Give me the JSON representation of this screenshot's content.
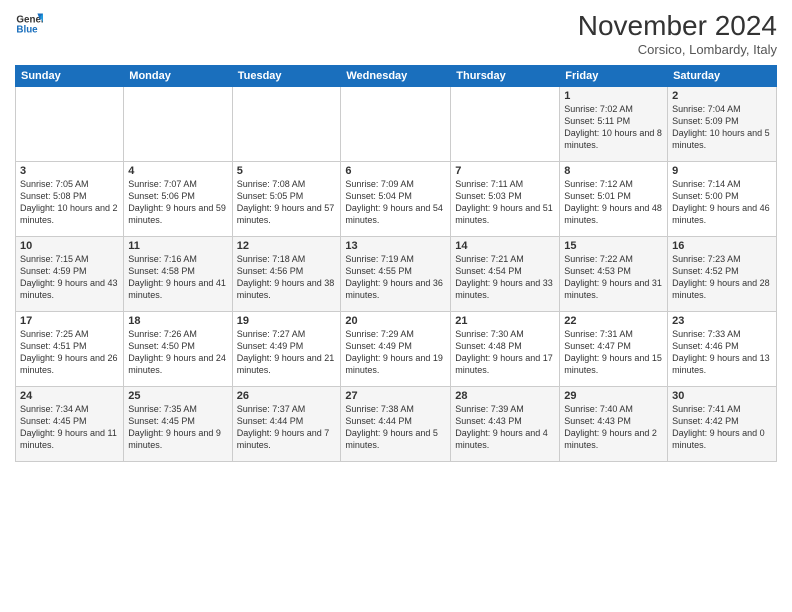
{
  "header": {
    "logo_line1": "General",
    "logo_line2": "Blue",
    "month": "November 2024",
    "location": "Corsico, Lombardy, Italy"
  },
  "weekdays": [
    "Sunday",
    "Monday",
    "Tuesday",
    "Wednesday",
    "Thursday",
    "Friday",
    "Saturday"
  ],
  "rows": [
    [
      {
        "day": "",
        "info": ""
      },
      {
        "day": "",
        "info": ""
      },
      {
        "day": "",
        "info": ""
      },
      {
        "day": "",
        "info": ""
      },
      {
        "day": "",
        "info": ""
      },
      {
        "day": "1",
        "info": "Sunrise: 7:02 AM\nSunset: 5:11 PM\nDaylight: 10 hours and 8 minutes."
      },
      {
        "day": "2",
        "info": "Sunrise: 7:04 AM\nSunset: 5:09 PM\nDaylight: 10 hours and 5 minutes."
      }
    ],
    [
      {
        "day": "3",
        "info": "Sunrise: 7:05 AM\nSunset: 5:08 PM\nDaylight: 10 hours and 2 minutes."
      },
      {
        "day": "4",
        "info": "Sunrise: 7:07 AM\nSunset: 5:06 PM\nDaylight: 9 hours and 59 minutes."
      },
      {
        "day": "5",
        "info": "Sunrise: 7:08 AM\nSunset: 5:05 PM\nDaylight: 9 hours and 57 minutes."
      },
      {
        "day": "6",
        "info": "Sunrise: 7:09 AM\nSunset: 5:04 PM\nDaylight: 9 hours and 54 minutes."
      },
      {
        "day": "7",
        "info": "Sunrise: 7:11 AM\nSunset: 5:03 PM\nDaylight: 9 hours and 51 minutes."
      },
      {
        "day": "8",
        "info": "Sunrise: 7:12 AM\nSunset: 5:01 PM\nDaylight: 9 hours and 48 minutes."
      },
      {
        "day": "9",
        "info": "Sunrise: 7:14 AM\nSunset: 5:00 PM\nDaylight: 9 hours and 46 minutes."
      }
    ],
    [
      {
        "day": "10",
        "info": "Sunrise: 7:15 AM\nSunset: 4:59 PM\nDaylight: 9 hours and 43 minutes."
      },
      {
        "day": "11",
        "info": "Sunrise: 7:16 AM\nSunset: 4:58 PM\nDaylight: 9 hours and 41 minutes."
      },
      {
        "day": "12",
        "info": "Sunrise: 7:18 AM\nSunset: 4:56 PM\nDaylight: 9 hours and 38 minutes."
      },
      {
        "day": "13",
        "info": "Sunrise: 7:19 AM\nSunset: 4:55 PM\nDaylight: 9 hours and 36 minutes."
      },
      {
        "day": "14",
        "info": "Sunrise: 7:21 AM\nSunset: 4:54 PM\nDaylight: 9 hours and 33 minutes."
      },
      {
        "day": "15",
        "info": "Sunrise: 7:22 AM\nSunset: 4:53 PM\nDaylight: 9 hours and 31 minutes."
      },
      {
        "day": "16",
        "info": "Sunrise: 7:23 AM\nSunset: 4:52 PM\nDaylight: 9 hours and 28 minutes."
      }
    ],
    [
      {
        "day": "17",
        "info": "Sunrise: 7:25 AM\nSunset: 4:51 PM\nDaylight: 9 hours and 26 minutes."
      },
      {
        "day": "18",
        "info": "Sunrise: 7:26 AM\nSunset: 4:50 PM\nDaylight: 9 hours and 24 minutes."
      },
      {
        "day": "19",
        "info": "Sunrise: 7:27 AM\nSunset: 4:49 PM\nDaylight: 9 hours and 21 minutes."
      },
      {
        "day": "20",
        "info": "Sunrise: 7:29 AM\nSunset: 4:49 PM\nDaylight: 9 hours and 19 minutes."
      },
      {
        "day": "21",
        "info": "Sunrise: 7:30 AM\nSunset: 4:48 PM\nDaylight: 9 hours and 17 minutes."
      },
      {
        "day": "22",
        "info": "Sunrise: 7:31 AM\nSunset: 4:47 PM\nDaylight: 9 hours and 15 minutes."
      },
      {
        "day": "23",
        "info": "Sunrise: 7:33 AM\nSunset: 4:46 PM\nDaylight: 9 hours and 13 minutes."
      }
    ],
    [
      {
        "day": "24",
        "info": "Sunrise: 7:34 AM\nSunset: 4:45 PM\nDaylight: 9 hours and 11 minutes."
      },
      {
        "day": "25",
        "info": "Sunrise: 7:35 AM\nSunset: 4:45 PM\nDaylight: 9 hours and 9 minutes."
      },
      {
        "day": "26",
        "info": "Sunrise: 7:37 AM\nSunset: 4:44 PM\nDaylight: 9 hours and 7 minutes."
      },
      {
        "day": "27",
        "info": "Sunrise: 7:38 AM\nSunset: 4:44 PM\nDaylight: 9 hours and 5 minutes."
      },
      {
        "day": "28",
        "info": "Sunrise: 7:39 AM\nSunset: 4:43 PM\nDaylight: 9 hours and 4 minutes."
      },
      {
        "day": "29",
        "info": "Sunrise: 7:40 AM\nSunset: 4:43 PM\nDaylight: 9 hours and 2 minutes."
      },
      {
        "day": "30",
        "info": "Sunrise: 7:41 AM\nSunset: 4:42 PM\nDaylight: 9 hours and 0 minutes."
      }
    ]
  ]
}
